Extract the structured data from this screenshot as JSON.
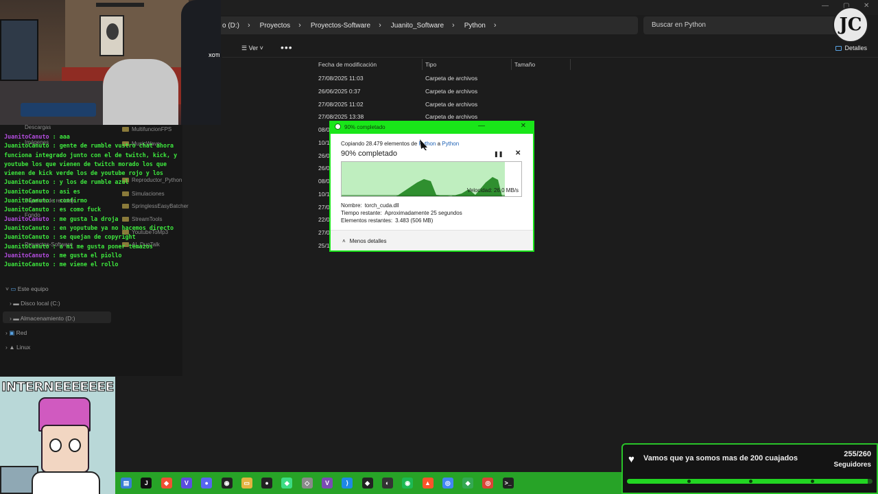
{
  "explorer": {
    "breadcrumbs": [
      "o (D:)",
      "Proyectos",
      "Proyectos-Software",
      "Juanito_Software",
      "Python"
    ],
    "search_placeholder": "Buscar en Python",
    "toolbar": {
      "view_label": "Ver",
      "more_label": "•••",
      "details_label": "Detalles"
    },
    "columns": {
      "date": "Fecha de modificación",
      "type": "Tipo",
      "size": "Tamaño"
    },
    "rows": [
      {
        "date": "27/08/2025 11:03",
        "type": "Carpeta de archivos"
      },
      {
        "date": "26/06/2025 0:37",
        "type": "Carpeta de archivos"
      },
      {
        "date": "27/08/2025 11:02",
        "type": "Carpeta de archivos"
      },
      {
        "date": "27/08/2025 13:38",
        "type": "Carpeta de archivos"
      },
      {
        "date": "08/0",
        "type": ""
      },
      {
        "date": "10/1",
        "type": ""
      },
      {
        "date": "26/0",
        "type": ""
      },
      {
        "date": "26/0",
        "type": ""
      },
      {
        "date": "08/0",
        "type": ""
      },
      {
        "date": "10/1",
        "type": ""
      },
      {
        "date": "27/0",
        "type": ""
      },
      {
        "date": "22/0",
        "type": ""
      },
      {
        "date": "27/0",
        "type": ""
      },
      {
        "date": "25/1",
        "type": ""
      }
    ],
    "nav_folders": [
      "MultifuncionFPS",
      "MusicWave",
      "Reproductor_Python",
      "Simulaciones",
      "SpringlessEasyBatcher",
      "StreamTools",
      "YoutubeToMp3",
      "AI_DuoTalk"
    ],
    "nav_quick": [
      "Descargas",
      "Imágenes",
      "Papelera de reciclaje",
      "Fondo",
      "Proyectos-Software"
    ],
    "nav_tree": {
      "this_pc": "Este equipo",
      "c_drive": "Disco local (C:)",
      "d_drive": "Almacenamiento (D:)",
      "network": "Red",
      "linux": "Linux"
    }
  },
  "chat": [
    {
      "user": "JuanitoCanuto",
      "color": "purple",
      "msg": "aaa"
    },
    {
      "user": "JuanitoCanuto",
      "color": "green",
      "msg": "gente de rumble vustro chat ahora funciona integrado junto con el de twitch, kick, y youtube los que vienen de twitch morado los que vienen de kick verde los de youtube rojo y los"
    },
    {
      "user": "JuanitoCanuto",
      "color": "green",
      "msg": "y los de rumble azul"
    },
    {
      "user": "JuanitoCanuto",
      "color": "green",
      "msg": "asi es"
    },
    {
      "user": "JuanitoCanuto",
      "color": "green",
      "msg": "confirmo"
    },
    {
      "user": "JuanitoCanuto",
      "color": "green",
      "msg": "es como fuck"
    },
    {
      "user": "JuanitoCanuto",
      "color": "purple",
      "msg": "me gusta la droja"
    },
    {
      "user": "JuanitoCanuto",
      "color": "green",
      "msg": "en yoputube ya no hacemos directo"
    },
    {
      "user": "JuanitoCanuto",
      "color": "green",
      "msg": "se quejan de copyright"
    },
    {
      "user": "JuanitoCanuto",
      "color": "green",
      "msg": "a mi me gusta poner temazos"
    },
    {
      "user": "JuanitoCanuto",
      "color": "purple",
      "msg": "me gusta el piollo"
    },
    {
      "user": "JuanitoCanuto",
      "color": "green",
      "msg": "me viene el rollo"
    }
  ],
  "copy_dialog": {
    "title": "90% completado",
    "copy_prefix": "Copiando 28.479 elementos de",
    "source": "Python",
    "connector": "a",
    "destination": "Python",
    "percent_label": "90% completado",
    "progress": 0.9,
    "speed_label": "Velocidad: 26,0 MB/s",
    "name_label": "Nombre:",
    "name_value": "torch_cuda.dll",
    "time_label": "Tiempo restante:",
    "time_value": "Aproximadamente 25 segundos",
    "items_label": "Elementos restantes:",
    "items_value": "3.483 (506 MB)",
    "less_details": "Menos detalles"
  },
  "avatar_banner": "INTERNEEEEEEE",
  "webcam_chair_text": "XOTI",
  "goal": {
    "title": "Vamos que ya somos mas de 200 cuajados",
    "count": "255/260",
    "unit": "Seguidores",
    "progress": 0.98
  },
  "logo_text": "JC",
  "colors": {
    "accent_green": "#19e619",
    "taskbar_green": "#27a327",
    "chat_green": "#3ee83e",
    "chat_purple": "#b44de0",
    "link_blue": "#1a5fb4"
  },
  "taskbar_icons": [
    "file-explorer-icon",
    "jetbrains-icon",
    "git-icon",
    "vivaldi-icon",
    "discord-icon",
    "obs-icon",
    "folder-icon",
    "github-icon",
    "android-studio-icon",
    "cube-icon",
    "visual-studio-icon",
    "vscode-icon",
    "unity-icon",
    "blender-icon",
    "spotify-icon",
    "brave-icon",
    "chrome-icon",
    "maps-icon",
    "chrome-alt-icon",
    "terminal-icon"
  ]
}
